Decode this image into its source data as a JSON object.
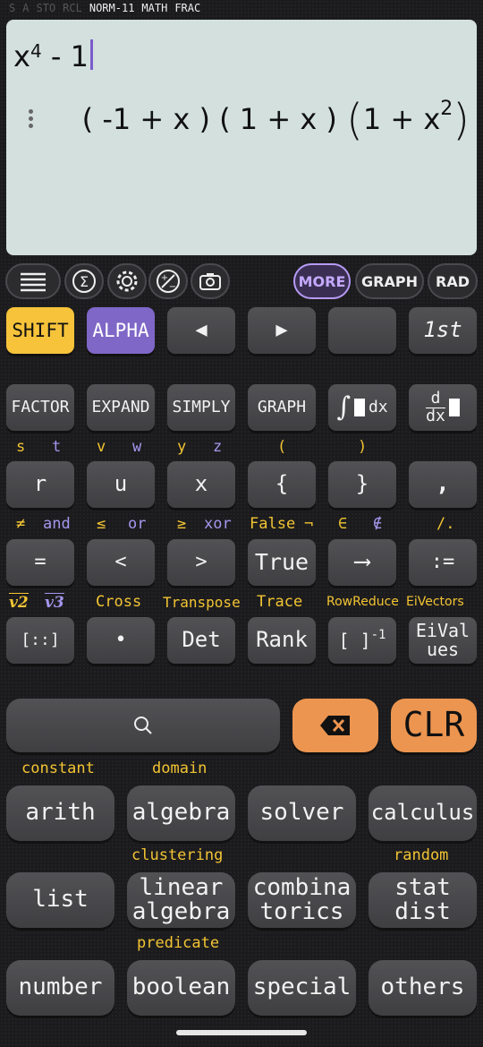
{
  "status_bar": {
    "indicators_dim": [
      "S",
      "A",
      "STO",
      "RCL"
    ],
    "indicators_on": [
      "NORM-11",
      "MATH",
      "FRAC"
    ]
  },
  "display": {
    "input_base": "x",
    "input_exp": "4",
    "input_rest": "- 1",
    "result_part1": "( -1 + x ) ( 1 + x )",
    "result_open": "(",
    "result_inner_base": "1 + x",
    "result_inner_exp": "2",
    "result_close": ")"
  },
  "toolbar": {
    "more": "MORE",
    "graph": "GRAPH",
    "rad": "RAD",
    "icons": [
      "menu-icon",
      "sigma-icon",
      "gear-icon",
      "plus-minus-icon",
      "camera-icon"
    ]
  },
  "row1": {
    "shift": "SHIFT",
    "alpha": "ALPHA",
    "left": "◀",
    "right": "▶",
    "blank": "",
    "first": "1st"
  },
  "row2": {
    "keys": [
      "FACTOR",
      "EXPAND",
      "SIMPLY",
      "GRAPH",
      "dx",
      "d/dx"
    ],
    "integral_symbol": "∫",
    "deriv_num": "d",
    "deriv_den": "dx"
  },
  "row3": {
    "shift_labels": [
      "s",
      "v",
      "y",
      "(",
      ")"
    ],
    "alpha_labels": [
      "t",
      "w",
      "z"
    ],
    "keys": [
      "r",
      "u",
      "x",
      "{",
      "}",
      "‚"
    ]
  },
  "row4": {
    "shift_labels": [
      "≠",
      "≤",
      "≥",
      "False",
      "∈",
      "/."
    ],
    "alpha_labels": [
      "and",
      "or",
      "xor",
      "¬",
      "∉"
    ],
    "keys": [
      "=",
      "<",
      ">",
      "True",
      "⟶",
      ":="
    ]
  },
  "row5": {
    "labels": [
      "v2",
      "v3",
      "Cross",
      "Transpose",
      "Trace",
      "RowReduce",
      "EiVectors"
    ],
    "keys": [
      "[::]",
      "•",
      "Det",
      "Rank",
      "[ ]",
      "-1",
      "EiVal",
      "ues"
    ]
  },
  "row6": {
    "search_icon": "search-icon",
    "backspace_icon": "backspace-icon",
    "clr": "CLR"
  },
  "menu": {
    "labels_a": [
      "constant",
      "domain"
    ],
    "row_a": [
      "arith",
      "algebra",
      "solver",
      "calculus"
    ],
    "labels_b": [
      "clustering",
      "random"
    ],
    "row_b": [
      [
        "list",
        ""
      ],
      [
        "linear",
        "algebra"
      ],
      [
        "combina",
        "torics"
      ],
      [
        "stat",
        "dist"
      ]
    ],
    "labels_c": [
      "predicate"
    ],
    "row_c": [
      "number",
      "boolean",
      "special",
      "others"
    ]
  },
  "colors": {
    "shift": "#f6c33a",
    "alpha": "#7f67c7",
    "orange": "#ec9550",
    "display": "#d3e0de"
  }
}
